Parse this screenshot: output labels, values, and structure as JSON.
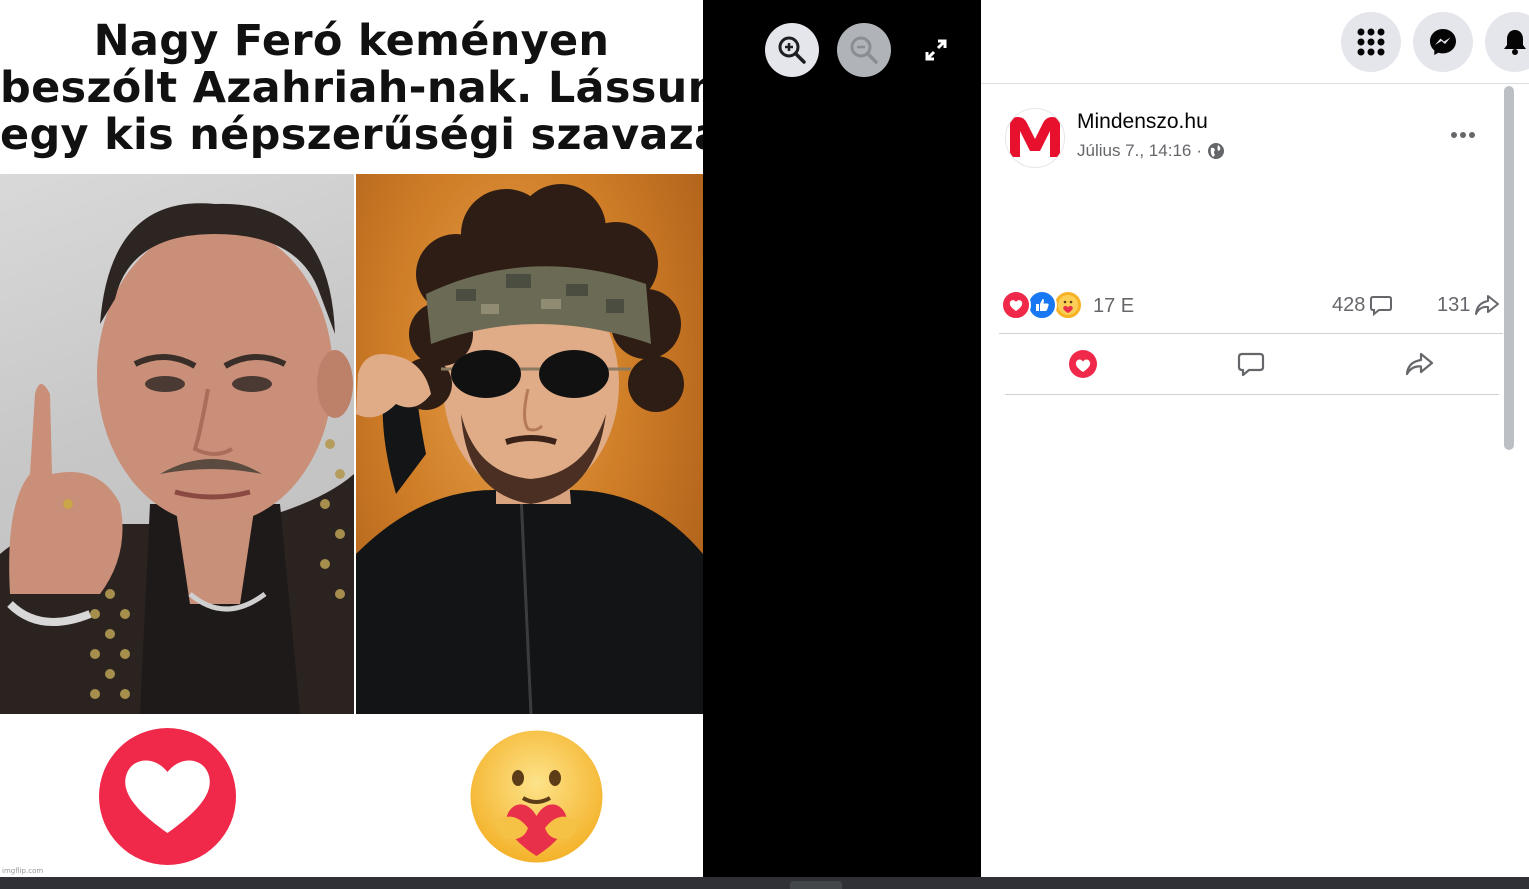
{
  "meme": {
    "title_lines": [
      "Nagy Feró keményen",
      "beszólt Azahriah-nak. Lássunk",
      "egy kis népszerűségi szavazást!"
    ],
    "watermark": "imgflip.com"
  },
  "viewer": {
    "zoom_in_icon": "zoom-in-icon",
    "zoom_out_icon": "zoom-out-icon",
    "fullscreen_icon": "expand-icon"
  },
  "post": {
    "page_name": "Mindenszo.hu",
    "date": "Július 7., 14:16",
    "separator": "·",
    "privacy_icon": "globe-icon",
    "reaction_count": "17 E",
    "comment_count": "428",
    "share_count": "131",
    "reactions": [
      "love",
      "like",
      "care"
    ]
  },
  "colors": {
    "love": "#f02849",
    "like": "#1877f2",
    "care": "#f7b125",
    "brand_red": "#e8112d"
  }
}
